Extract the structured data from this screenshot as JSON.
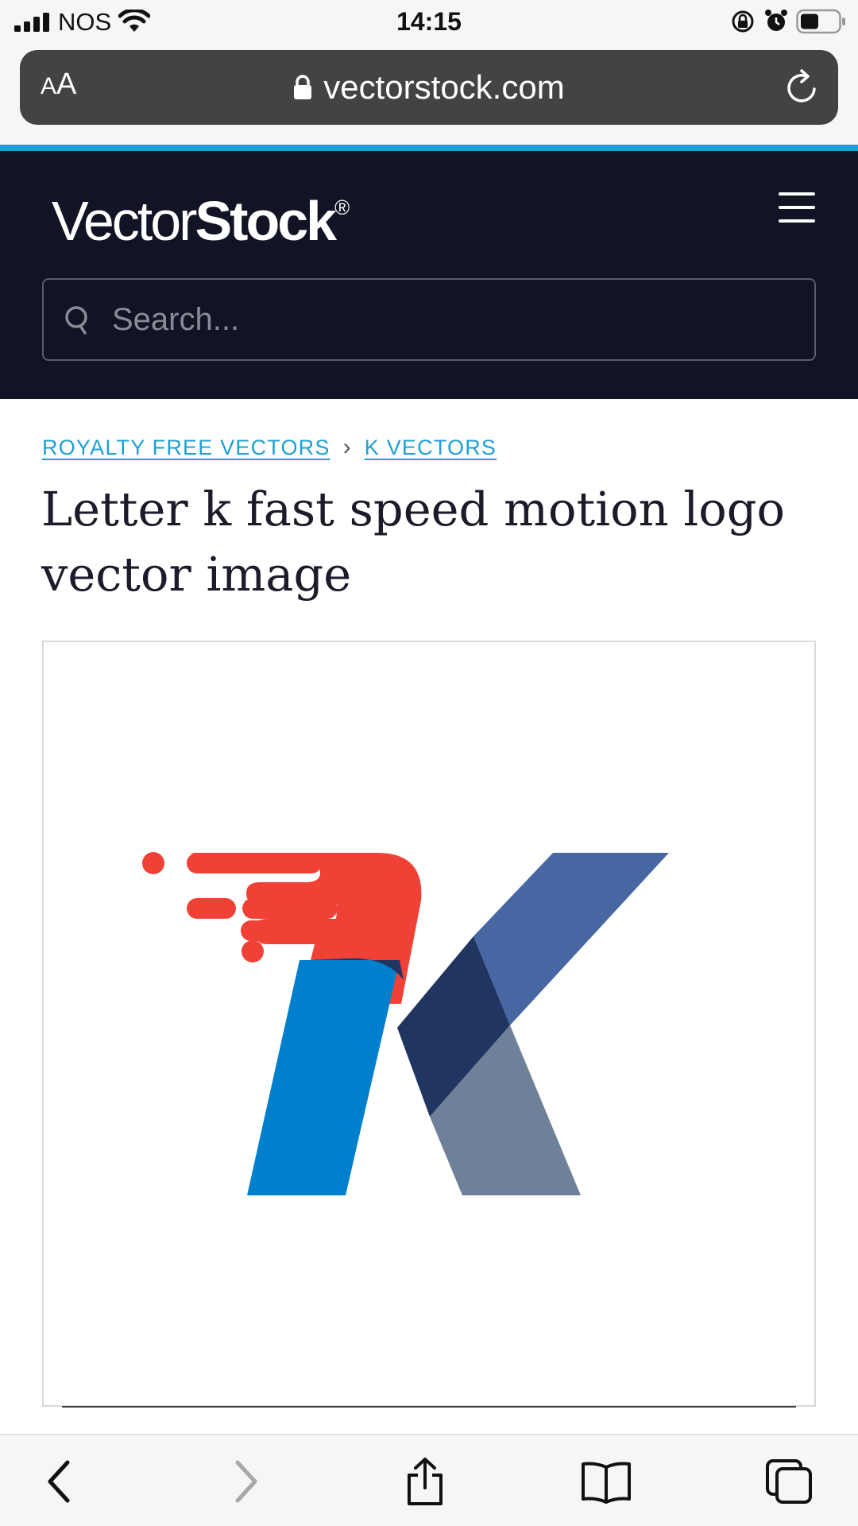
{
  "status_bar": {
    "carrier": "NOS",
    "time": "14:15"
  },
  "safari": {
    "text_size_label_small": "A",
    "text_size_label_big": "A",
    "url": "vectorstock.com"
  },
  "site": {
    "logo_light": "Vector",
    "logo_bold": "Stock",
    "logo_mark": "®",
    "search_placeholder": "Search..."
  },
  "breadcrumb": {
    "items": [
      "ROYALTY FREE VECTORS",
      "K VECTORS"
    ],
    "separator": "›"
  },
  "page": {
    "title": "Letter k fast speed motion logo vector image"
  },
  "colors": {
    "header_bg": "#121324",
    "accent_blue": "#1aa3db",
    "logo_red": "#f04136",
    "logo_blue": "#0080cc",
    "logo_slate": "#4767a3",
    "logo_navy": "#213561",
    "logo_grey": "#6f8198"
  },
  "icons": {
    "status": [
      "cellular-signal-icon",
      "wifi-icon",
      "rotation-lock-icon",
      "alarm-icon",
      "battery-icon"
    ],
    "safari": [
      "lock-icon",
      "reload-icon"
    ],
    "toolbar": [
      "back-icon",
      "forward-icon",
      "share-icon",
      "bookmarks-icon",
      "tabs-icon"
    ]
  }
}
